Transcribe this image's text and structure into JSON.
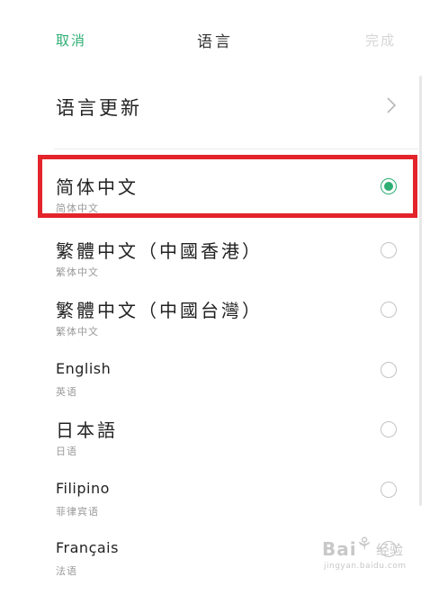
{
  "header": {
    "cancel": "取消",
    "title": "语言",
    "done": "完成"
  },
  "language_update": {
    "label": "语言更新",
    "chevron_icon": "chevron-right-icon"
  },
  "languages": [
    {
      "name": "简体中文",
      "sub": "简体中文",
      "selected": true
    },
    {
      "name": "繁體中文（中國香港）",
      "sub": "繁体中文",
      "selected": false
    },
    {
      "name": "繁體中文（中國台灣）",
      "sub": "繁体中文",
      "selected": false
    },
    {
      "name": "English",
      "sub": "英语",
      "selected": false
    },
    {
      "name": "日本語",
      "sub": "日语",
      "selected": false
    },
    {
      "name": "Filipino",
      "sub": "菲律宾语",
      "selected": false
    },
    {
      "name": "Français",
      "sub": "法语",
      "selected": false
    }
  ],
  "colors": {
    "accent": "#2fae74",
    "highlight_box": "#e3242b",
    "disabled_text": "#d6d6d6"
  },
  "watermark": {
    "brand": "Bai",
    "suffix": "经验",
    "url": "jingyan.baidu.com"
  }
}
